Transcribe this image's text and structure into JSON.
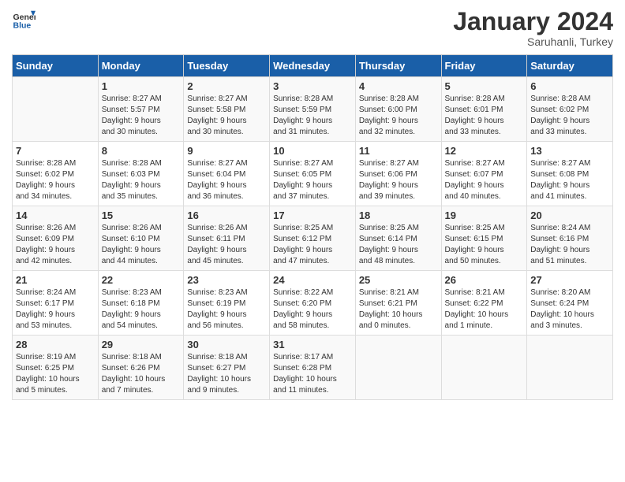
{
  "header": {
    "logo_general": "General",
    "logo_blue": "Blue",
    "month_title": "January 2024",
    "subtitle": "Saruhanli, Turkey"
  },
  "columns": [
    "Sunday",
    "Monday",
    "Tuesday",
    "Wednesday",
    "Thursday",
    "Friday",
    "Saturday"
  ],
  "weeks": [
    [
      {
        "day": "",
        "info": ""
      },
      {
        "day": "1",
        "info": "Sunrise: 8:27 AM\nSunset: 5:57 PM\nDaylight: 9 hours\nand 30 minutes."
      },
      {
        "day": "2",
        "info": "Sunrise: 8:27 AM\nSunset: 5:58 PM\nDaylight: 9 hours\nand 30 minutes."
      },
      {
        "day": "3",
        "info": "Sunrise: 8:28 AM\nSunset: 5:59 PM\nDaylight: 9 hours\nand 31 minutes."
      },
      {
        "day": "4",
        "info": "Sunrise: 8:28 AM\nSunset: 6:00 PM\nDaylight: 9 hours\nand 32 minutes."
      },
      {
        "day": "5",
        "info": "Sunrise: 8:28 AM\nSunset: 6:01 PM\nDaylight: 9 hours\nand 33 minutes."
      },
      {
        "day": "6",
        "info": "Sunrise: 8:28 AM\nSunset: 6:02 PM\nDaylight: 9 hours\nand 33 minutes."
      }
    ],
    [
      {
        "day": "7",
        "info": "Sunrise: 8:28 AM\nSunset: 6:02 PM\nDaylight: 9 hours\nand 34 minutes."
      },
      {
        "day": "8",
        "info": "Sunrise: 8:28 AM\nSunset: 6:03 PM\nDaylight: 9 hours\nand 35 minutes."
      },
      {
        "day": "9",
        "info": "Sunrise: 8:27 AM\nSunset: 6:04 PM\nDaylight: 9 hours\nand 36 minutes."
      },
      {
        "day": "10",
        "info": "Sunrise: 8:27 AM\nSunset: 6:05 PM\nDaylight: 9 hours\nand 37 minutes."
      },
      {
        "day": "11",
        "info": "Sunrise: 8:27 AM\nSunset: 6:06 PM\nDaylight: 9 hours\nand 39 minutes."
      },
      {
        "day": "12",
        "info": "Sunrise: 8:27 AM\nSunset: 6:07 PM\nDaylight: 9 hours\nand 40 minutes."
      },
      {
        "day": "13",
        "info": "Sunrise: 8:27 AM\nSunset: 6:08 PM\nDaylight: 9 hours\nand 41 minutes."
      }
    ],
    [
      {
        "day": "14",
        "info": "Sunrise: 8:26 AM\nSunset: 6:09 PM\nDaylight: 9 hours\nand 42 minutes."
      },
      {
        "day": "15",
        "info": "Sunrise: 8:26 AM\nSunset: 6:10 PM\nDaylight: 9 hours\nand 44 minutes."
      },
      {
        "day": "16",
        "info": "Sunrise: 8:26 AM\nSunset: 6:11 PM\nDaylight: 9 hours\nand 45 minutes."
      },
      {
        "day": "17",
        "info": "Sunrise: 8:25 AM\nSunset: 6:12 PM\nDaylight: 9 hours\nand 47 minutes."
      },
      {
        "day": "18",
        "info": "Sunrise: 8:25 AM\nSunset: 6:14 PM\nDaylight: 9 hours\nand 48 minutes."
      },
      {
        "day": "19",
        "info": "Sunrise: 8:25 AM\nSunset: 6:15 PM\nDaylight: 9 hours\nand 50 minutes."
      },
      {
        "day": "20",
        "info": "Sunrise: 8:24 AM\nSunset: 6:16 PM\nDaylight: 9 hours\nand 51 minutes."
      }
    ],
    [
      {
        "day": "21",
        "info": "Sunrise: 8:24 AM\nSunset: 6:17 PM\nDaylight: 9 hours\nand 53 minutes."
      },
      {
        "day": "22",
        "info": "Sunrise: 8:23 AM\nSunset: 6:18 PM\nDaylight: 9 hours\nand 54 minutes."
      },
      {
        "day": "23",
        "info": "Sunrise: 8:23 AM\nSunset: 6:19 PM\nDaylight: 9 hours\nand 56 minutes."
      },
      {
        "day": "24",
        "info": "Sunrise: 8:22 AM\nSunset: 6:20 PM\nDaylight: 9 hours\nand 58 minutes."
      },
      {
        "day": "25",
        "info": "Sunrise: 8:21 AM\nSunset: 6:21 PM\nDaylight: 10 hours\nand 0 minutes."
      },
      {
        "day": "26",
        "info": "Sunrise: 8:21 AM\nSunset: 6:22 PM\nDaylight: 10 hours\nand 1 minute."
      },
      {
        "day": "27",
        "info": "Sunrise: 8:20 AM\nSunset: 6:24 PM\nDaylight: 10 hours\nand 3 minutes."
      }
    ],
    [
      {
        "day": "28",
        "info": "Sunrise: 8:19 AM\nSunset: 6:25 PM\nDaylight: 10 hours\nand 5 minutes."
      },
      {
        "day": "29",
        "info": "Sunrise: 8:18 AM\nSunset: 6:26 PM\nDaylight: 10 hours\nand 7 minutes."
      },
      {
        "day": "30",
        "info": "Sunrise: 8:18 AM\nSunset: 6:27 PM\nDaylight: 10 hours\nand 9 minutes."
      },
      {
        "day": "31",
        "info": "Sunrise: 8:17 AM\nSunset: 6:28 PM\nDaylight: 10 hours\nand 11 minutes."
      },
      {
        "day": "",
        "info": ""
      },
      {
        "day": "",
        "info": ""
      },
      {
        "day": "",
        "info": ""
      }
    ]
  ]
}
